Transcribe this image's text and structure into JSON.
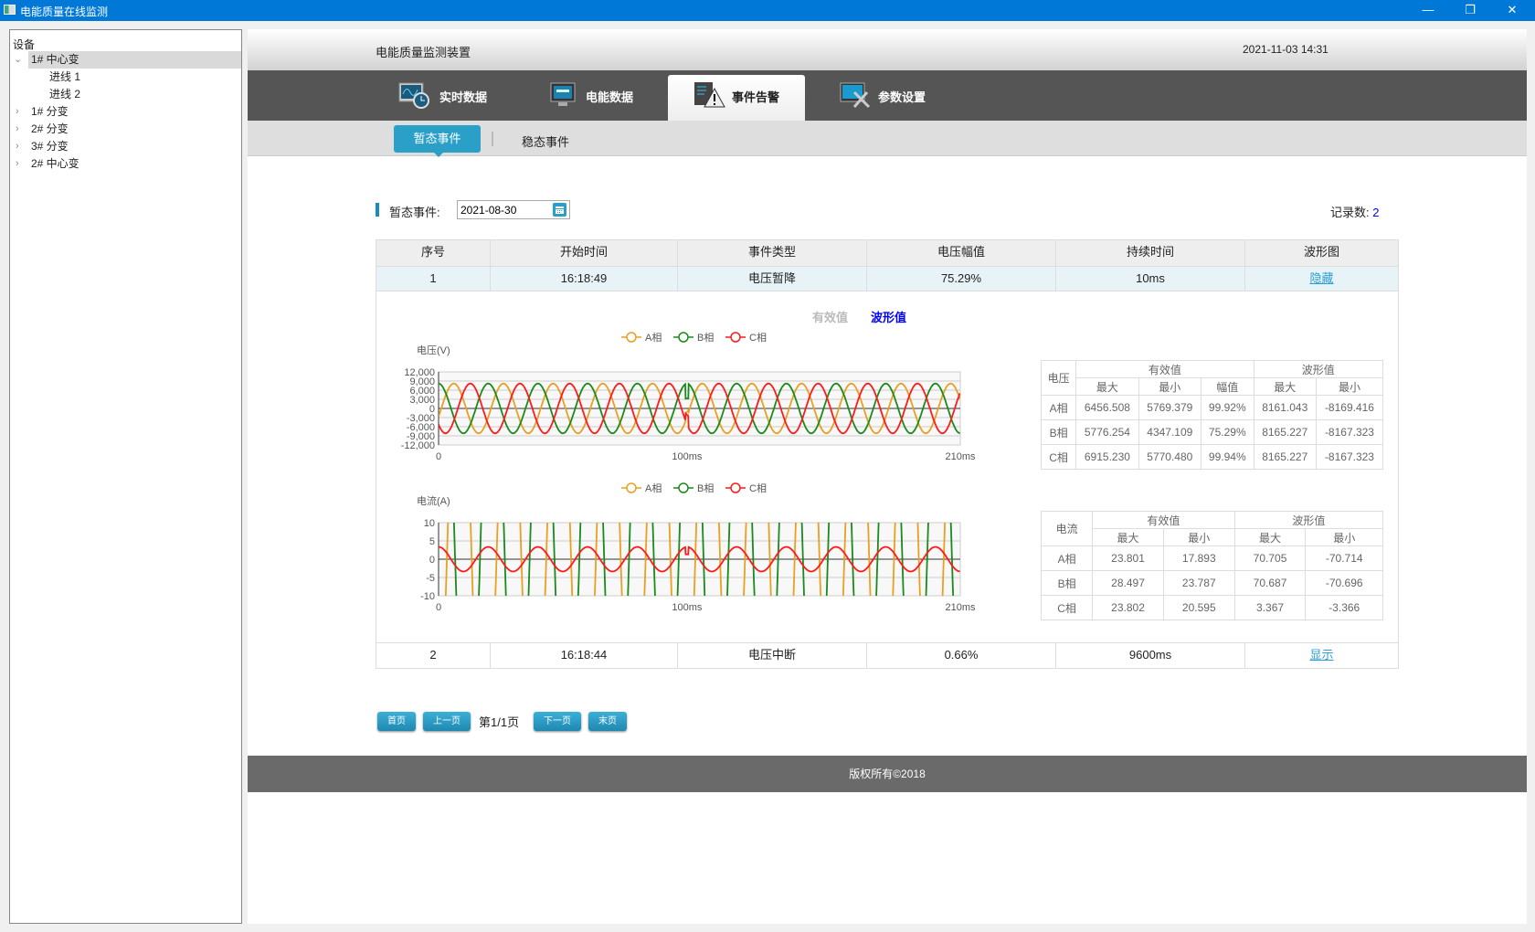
{
  "window": {
    "title": "电能质量在线监测",
    "controls": [
      "minimize",
      "restore",
      "close"
    ]
  },
  "sidebar": {
    "root": "设备",
    "items": [
      {
        "label": "1#  中心变",
        "expanded": true,
        "selected": true
      },
      {
        "label": "进线  1",
        "child": true
      },
      {
        "label": "进线  2",
        "child": true
      },
      {
        "label": "1# 分变"
      },
      {
        "label": "2# 分变"
      },
      {
        "label": "3# 分变"
      },
      {
        "label": "2#  中心变"
      }
    ]
  },
  "header": {
    "title": "电能质量监测装置",
    "datetime": "2021-11-03 14:31"
  },
  "nav": {
    "tabs": [
      {
        "label": "实时数据",
        "icon": "realtime-monitor-icon"
      },
      {
        "label": "电能数据",
        "icon": "energy-data-icon"
      },
      {
        "label": "事件告警",
        "icon": "event-alarm-icon",
        "active": true
      },
      {
        "label": "参数设置",
        "icon": "settings-tools-icon"
      }
    ]
  },
  "subnav": {
    "items": [
      "暂态事件",
      "稳态事件"
    ],
    "active": "暂态事件"
  },
  "filter": {
    "label": "暂态事件:",
    "date": "2021-08-30",
    "count_label": "记录数:",
    "count": "2"
  },
  "events": {
    "columns": [
      "序号",
      "开始时间",
      "事件类型",
      "电压幅值",
      "持续时间",
      "波形图"
    ],
    "rows": [
      {
        "no": "1",
        "start": "16:18:49",
        "type": "电压暂降",
        "amplitude": "75.29%",
        "duration": "10ms",
        "action": "隐藏"
      },
      {
        "no": "2",
        "start": "16:18:44",
        "type": "电压中断",
        "amplitude": "0.66%",
        "duration": "9600ms",
        "action": "显示"
      }
    ]
  },
  "detail": {
    "toggle": {
      "rms": "有效值",
      "wave": "波形值",
      "active": "波形值",
      "inactive_color": "#bbbbbb",
      "active_color": "#0000ff"
    },
    "voltage_table": {
      "corner": "电压",
      "group_rms": "有效值",
      "group_wave": "波形值",
      "sub": [
        "最大",
        "最小",
        "幅值",
        "最大",
        "最小"
      ],
      "rows": [
        [
          "A相",
          "6456.508",
          "5769.379",
          "99.92%",
          "8161.043",
          "-8169.416"
        ],
        [
          "B相",
          "5776.254",
          "4347.109",
          "75.29%",
          "8165.227",
          "-8167.323"
        ],
        [
          "C相",
          "6915.230",
          "5770.480",
          "99.94%",
          "8165.227",
          "-8167.323"
        ]
      ]
    },
    "current_table": {
      "corner": "电流",
      "group_rms": "有效值",
      "group_wave": "波形值",
      "sub": [
        "最大",
        "最小",
        "最大",
        "最小"
      ],
      "rows": [
        [
          "A相",
          "23.801",
          "17.893",
          "70.705",
          "-70.714"
        ],
        [
          "B相",
          "28.497",
          "23.787",
          "70.687",
          "-70.696"
        ],
        [
          "C相",
          "23.802",
          "20.595",
          "3.367",
          "-3.366"
        ]
      ]
    }
  },
  "pagination": {
    "first": "首页",
    "prev": "上一页",
    "status": "第1/1页",
    "next": "下一页",
    "last": "末页"
  },
  "footer": {
    "text": "版权所有©2018"
  },
  "chart_data": [
    {
      "type": "line",
      "ylabel": "电压(V)",
      "ylim": [
        -12000,
        12000
      ],
      "yticks": [
        "12,000",
        "9,000",
        "6,000",
        "3,000",
        "0",
        "-3,000",
        "-6,000",
        "-9,000",
        "-12,000"
      ],
      "xlim": [
        0,
        210
      ],
      "xticks": [
        {
          "v": 0,
          "label": "0"
        },
        {
          "v": 100,
          "label": "100ms"
        },
        {
          "v": 210,
          "label": "210ms"
        }
      ],
      "grid": true,
      "legend": "top-center",
      "frequency_hz": 50,
      "disturbance_ms": 100,
      "series": [
        {
          "name": "A相",
          "color": "#e8a020",
          "amplitude": 8165,
          "phase_deg": -20
        },
        {
          "name": "B相",
          "color": "#1a8a1a",
          "amplitude": 8165,
          "phase_deg": 90
        },
        {
          "name": "C相",
          "color": "#ff1a1a",
          "amplitude": 8165,
          "phase_deg": -140
        }
      ]
    },
    {
      "type": "line",
      "ylabel": "电流(A)",
      "ylim": [
        -10,
        10
      ],
      "yticks": [
        "10",
        "5",
        "0",
        "-5",
        "-10"
      ],
      "xlim": [
        0,
        210
      ],
      "xticks": [
        {
          "v": 0,
          "label": "0"
        },
        {
          "v": 100,
          "label": "100ms"
        },
        {
          "v": 210,
          "label": "210ms"
        }
      ],
      "grid": true,
      "legend": "top-center",
      "frequency_hz": 50,
      "disturbance_ms": 100,
      "series": [
        {
          "name": "A相",
          "color": "#e8a020",
          "amplitude": 70.7,
          "phase_deg": -60
        },
        {
          "name": "B相",
          "color": "#1a8a1a",
          "amplitude": 70.7,
          "phase_deg": 60
        },
        {
          "name": "C相",
          "color": "#ff1a1a",
          "amplitude": 3.367,
          "phase_deg": 90
        }
      ]
    }
  ]
}
